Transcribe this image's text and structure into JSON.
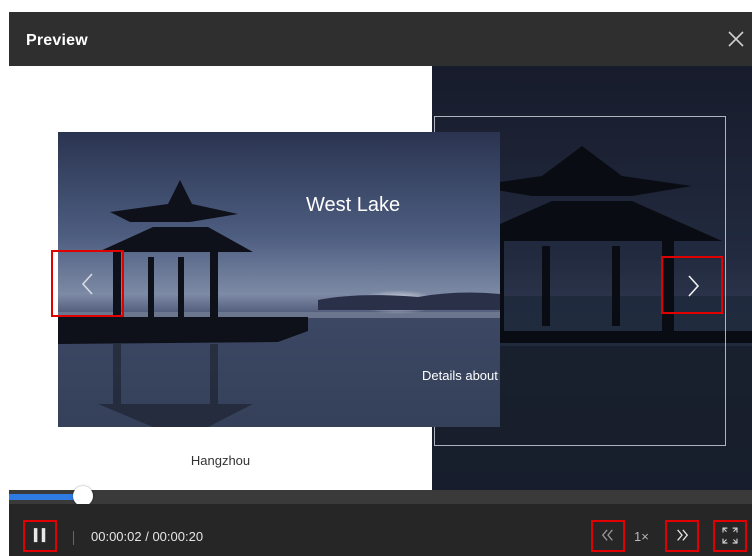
{
  "dialog": {
    "title": "Preview",
    "close_icon": "close-icon"
  },
  "slide": {
    "title": "West Lake",
    "details": "Details about the West Lake",
    "caption": "Hangzhou",
    "prev_icon": "chevron-left-icon",
    "next_icon": "chevron-right-icon"
  },
  "player": {
    "progress_fraction": 0.1,
    "time": "00:00:02 / 00:00:20",
    "speed": "1×",
    "pause_icon": "pause-icon",
    "rewind_icon": "rewind-icon",
    "forward_icon": "fast-forward-icon",
    "fullscreen_icon": "fullscreen-icon"
  },
  "colors": {
    "highlight_box": "#e00000",
    "progress": "#2e7be4",
    "header": "#2f2f2f",
    "controls": "#262626"
  }
}
